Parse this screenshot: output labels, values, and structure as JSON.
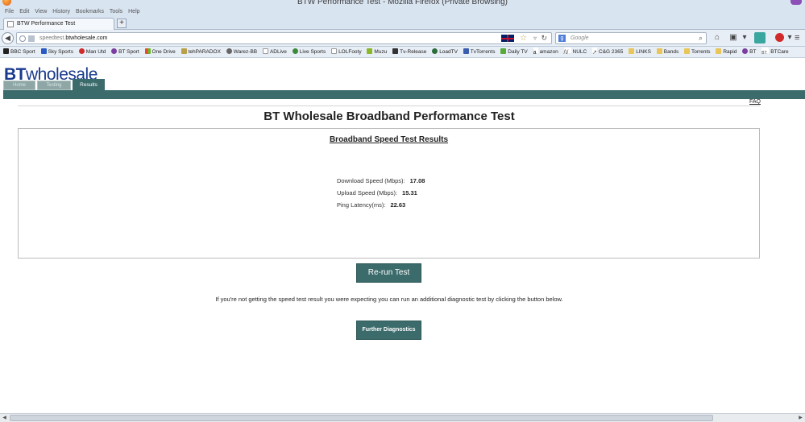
{
  "window": {
    "title": "BTW Performance Test - Mozilla Firefox (Private Browsing)"
  },
  "menu": [
    "File",
    "Edit",
    "View",
    "History",
    "Bookmarks",
    "Tools",
    "Help"
  ],
  "tab": {
    "label": "BTW Performance Test",
    "new_tab": "+"
  },
  "address": {
    "url_prefix": "speedtest.",
    "url_domain": "btwholesale.com"
  },
  "search": {
    "placeholder": "Google",
    "engine_letter": "g"
  },
  "bookmarks": [
    {
      "label": "BBC Sport",
      "color": "#222"
    },
    {
      "label": "Sky Sports",
      "color": "#2a5bc4"
    },
    {
      "label": "Man Utd",
      "color": "#d12a2a"
    },
    {
      "label": "BT Sport",
      "color": "#7a3ea0"
    },
    {
      "label": "One Drive",
      "color": "#e8a21a"
    },
    {
      "label": "tehPARADOX",
      "color": "#b8a04a"
    },
    {
      "label": "Warez-BB",
      "color": "#666"
    },
    {
      "label": "ADLive",
      "color": "#fff"
    },
    {
      "label": "Live Sports",
      "color": "#3a8a3a"
    },
    {
      "label": "LOLFooty",
      "color": "#fff"
    },
    {
      "label": "Muzu",
      "color": "#8ab82a"
    },
    {
      "label": "Tv-Release",
      "color": "#333"
    },
    {
      "label": "LoadTV",
      "color": "#2c6d3a"
    },
    {
      "label": "TvTorrents",
      "color": "#3a5db0"
    },
    {
      "label": "Daily TV",
      "color": "#5aaa3a"
    },
    {
      "label": "amazon",
      "color": "#222"
    },
    {
      "label": "NULC",
      "color": "#444"
    },
    {
      "label": "C&G 2365",
      "color": "#555"
    },
    {
      "label": "LINKS",
      "color": "#e8c65a"
    },
    {
      "label": "Bands",
      "color": "#e8c65a"
    },
    {
      "label": "Torrents",
      "color": "#e8c65a"
    },
    {
      "label": "Rapid",
      "color": "#e8c65a"
    },
    {
      "label": "BT",
      "color": "#7a3ea0"
    },
    {
      "label": "BTCare",
      "color": "#7a3ea0"
    }
  ],
  "site": {
    "logo_bt": "BT",
    "logo_wholesale": "wholesale",
    "tabs": [
      "Home",
      "Testing",
      "Results"
    ],
    "faq": "FAQ",
    "heading": "BT Wholesale Broadband Performance Test",
    "results_heading": "Broadband Speed Test Results",
    "metrics": [
      {
        "label": "Download Speed (Mbps):",
        "value": "17.08"
      },
      {
        "label": "Upload Speed (Mbps):",
        "value": "15.31"
      },
      {
        "label": "Ping Latency(ms):",
        "value": "22.63"
      }
    ],
    "rerun_label": "Re-run Test",
    "notice": "If you're not getting the speed test result you were expecting you can run an additional diagnostic test by clicking the button below.",
    "diagnostics_label": "Further Diagnostics"
  },
  "colors": {
    "brand_teal": "#3c6b6c",
    "logo_blue": "#1a3a8c"
  }
}
